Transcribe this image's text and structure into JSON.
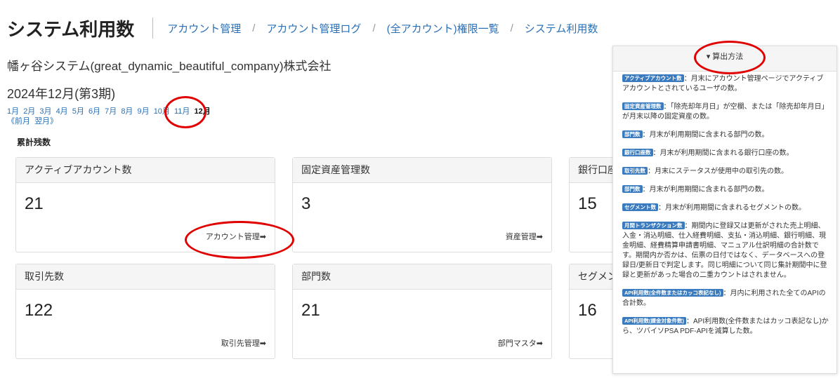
{
  "header": {
    "title": "システム利用数",
    "breadcrumb": [
      "アカウント管理",
      "アカウント管理ログ",
      "(全アカウント)権限一覧",
      "システム利用数"
    ]
  },
  "company": "幡ヶ谷システム(great_dynamic_beautiful_company)株式会社",
  "period": "2024年12月(第3期)",
  "months": [
    "1月",
    "2月",
    "3月",
    "4月",
    "5月",
    "6月",
    "7月",
    "8月",
    "9月",
    "10月",
    "11月",
    "12月"
  ],
  "current_month": "12月",
  "nav": {
    "prev": "《前月",
    "next": "翌月》"
  },
  "section_title": "累計残数",
  "cards": [
    {
      "title": "アクティブアカウント数",
      "value": "21",
      "link": "アカウント管理➡"
    },
    {
      "title": "固定資産管理数",
      "value": "3",
      "link": "資産管理➡"
    },
    {
      "title": "銀行口座",
      "value": "15",
      "link": ""
    },
    {
      "title": "取引先数",
      "value": "122",
      "link": "取引先管理➡"
    },
    {
      "title": "部門数",
      "value": "21",
      "link": "部門マスタ➡"
    },
    {
      "title": "セグメン",
      "value": "16",
      "link": ""
    }
  ],
  "panel": {
    "title": "▾ 算出方法",
    "items": [
      {
        "badge": "アクティブアカウント数",
        "text": "：月末にアカウント管理ページでアクティブアカウントとされているユーザの数。"
      },
      {
        "badge": "固定資産管理数",
        "text": "：「除売却年月日」が空欄、または「除売却年月日」が月末以降の固定資産の数。"
      },
      {
        "badge": "部門数",
        "text": "：月末が利用期間に含まれる部門の数。"
      },
      {
        "badge": "銀行口座数",
        "text": "：月末が利用期間に含まれる銀行口座の数。"
      },
      {
        "badge": "取引先数",
        "text": "：月末にステータスが使用中の取引先の数。"
      },
      {
        "badge": "部門数",
        "text": "：月末が利用期間に含まれる部門の数。"
      },
      {
        "badge": "セグメント数",
        "text": "：月末が利用期間に含まれるセグメントの数。"
      },
      {
        "badge": "月間トランザクション数",
        "text": "：期間内に登録又は更新がされた売上明細、入金・消込明細、仕入経費明細、支払・消込明細、銀行明細、現金明細、経費精算申請書明細、マニュアル仕訳明細の合計数です。期間内か否かは、伝票の日付ではなく、データベースへの登録日/更新日で判定します。同じ明細について同じ集計期間中に登録と更新があった場合の二重カウントはされません。"
      },
      {
        "badge": "API利用数(全件数またはカッコ表記なし)",
        "text": "：月内に利用された全てのAPIの合計数。"
      },
      {
        "badge": "API利用数(課金対象件数)",
        "text": "：API利用数(全件数またはカッコ表記なし)から、ツバイソPSA PDF-APIを減算した数。"
      }
    ]
  },
  "colors": {
    "link": "#2a6fb5",
    "badge": "#3a7bbf",
    "highlight": "#e00000"
  }
}
